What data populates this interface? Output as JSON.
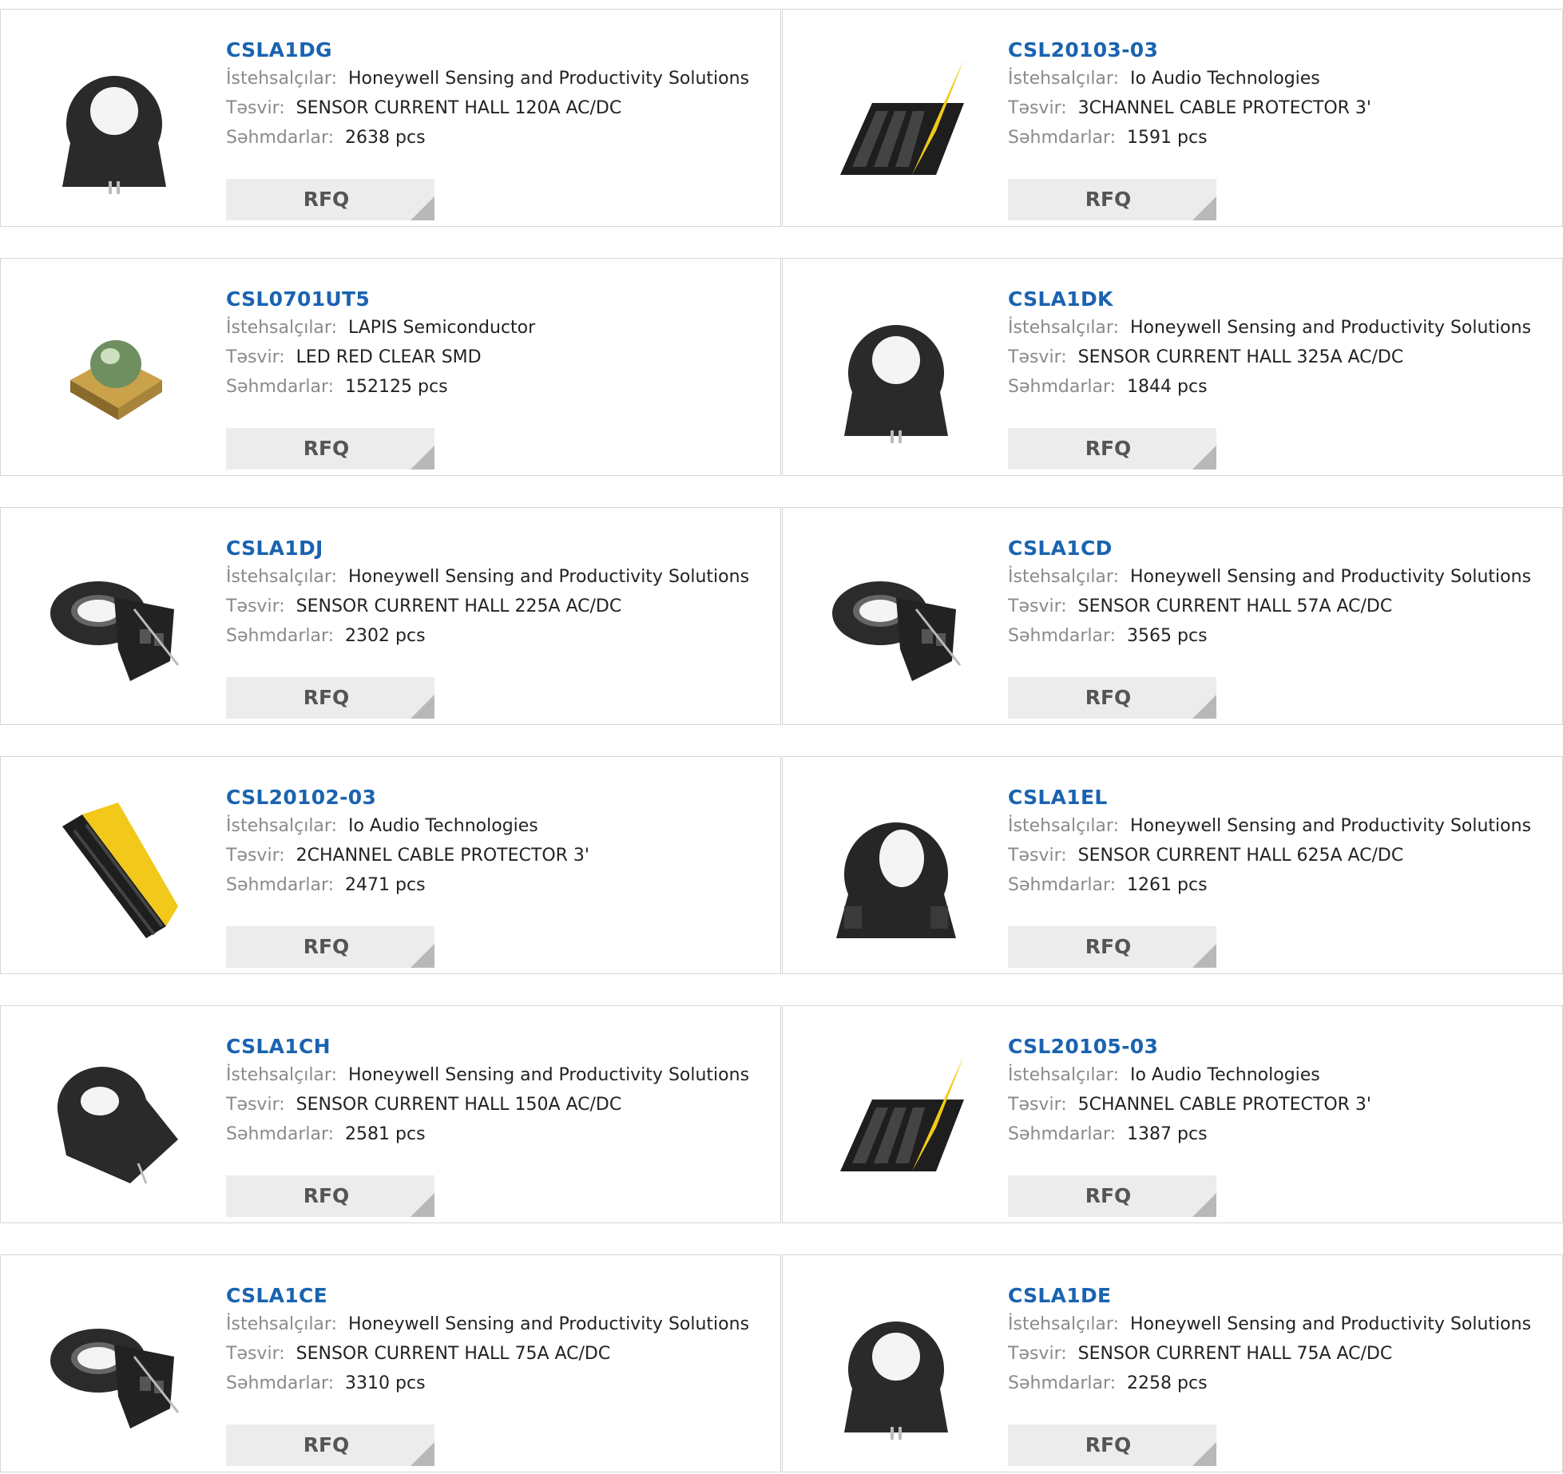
{
  "labels": {
    "manufacturer": "İstehsalçılar:",
    "description": "Təsvir:",
    "stock": "Səhmdarlar:",
    "rfq": "RFQ"
  },
  "colors": {
    "part_number": "#1a63b0",
    "label": "#8a8a8a",
    "rfq_bg": "#ececec",
    "border": "#d6d6d6"
  },
  "products": [
    {
      "part": "CSLA1DG",
      "manufacturer": "Honeywell Sensing and Productivity Solutions",
      "description": "SENSOR CURRENT HALL 120A AC/DC",
      "stock": "2638 pcs",
      "image": "hall-sensor-ring-upright"
    },
    {
      "part": "CSL20103-03",
      "manufacturer": "Io Audio Technologies",
      "description": "3CHANNEL CABLE PROTECTOR 3'",
      "stock": "1591 pcs",
      "image": "cable-protector"
    },
    {
      "part": "CSL0701UT5",
      "manufacturer": "LAPIS Semiconductor",
      "description": "LED RED CLEAR SMD",
      "stock": "152125 pcs",
      "image": "smd-led"
    },
    {
      "part": "CSLA1DK",
      "manufacturer": "Honeywell Sensing and Productivity Solutions",
      "description": "SENSOR CURRENT HALL 325A AC/DC",
      "stock": "1844 pcs",
      "image": "hall-sensor-ring-upright"
    },
    {
      "part": "CSLA1DJ",
      "manufacturer": "Honeywell Sensing and Productivity Solutions",
      "description": "SENSOR CURRENT HALL 225A AC/DC",
      "stock": "2302 pcs",
      "image": "hall-sensor-flat"
    },
    {
      "part": "CSLA1CD",
      "manufacturer": "Honeywell Sensing and Productivity Solutions",
      "description": "SENSOR CURRENT HALL 57A AC/DC",
      "stock": "3565 pcs",
      "image": "hall-sensor-flat"
    },
    {
      "part": "CSL20102-03",
      "manufacturer": "Io Audio Technologies",
      "description": "2CHANNEL CABLE PROTECTOR 3'",
      "stock": "2471 pcs",
      "image": "cable-protector-diagonal"
    },
    {
      "part": "CSLA1EL",
      "manufacturer": "Honeywell Sensing and Productivity Solutions",
      "description": "SENSOR CURRENT HALL 625A AC/DC",
      "stock": "1261 pcs",
      "image": "hall-sensor-ring-large"
    },
    {
      "part": "CSLA1CH",
      "manufacturer": "Honeywell Sensing and Productivity Solutions",
      "description": "SENSOR CURRENT HALL 150A AC/DC",
      "stock": "2581 pcs",
      "image": "hall-sensor-tilted"
    },
    {
      "part": "CSL20105-03",
      "manufacturer": "Io Audio Technologies",
      "description": "5CHANNEL CABLE PROTECTOR 3'",
      "stock": "1387 pcs",
      "image": "cable-protector"
    },
    {
      "part": "CSLA1CE",
      "manufacturer": "Honeywell Sensing and Productivity Solutions",
      "description": "SENSOR CURRENT HALL 75A AC/DC",
      "stock": "3310 pcs",
      "image": "hall-sensor-flat"
    },
    {
      "part": "CSLA1DE",
      "manufacturer": "Honeywell Sensing and Productivity Solutions",
      "description": "SENSOR CURRENT HALL 75A AC/DC",
      "stock": "2258 pcs",
      "image": "hall-sensor-ring-upright"
    }
  ]
}
